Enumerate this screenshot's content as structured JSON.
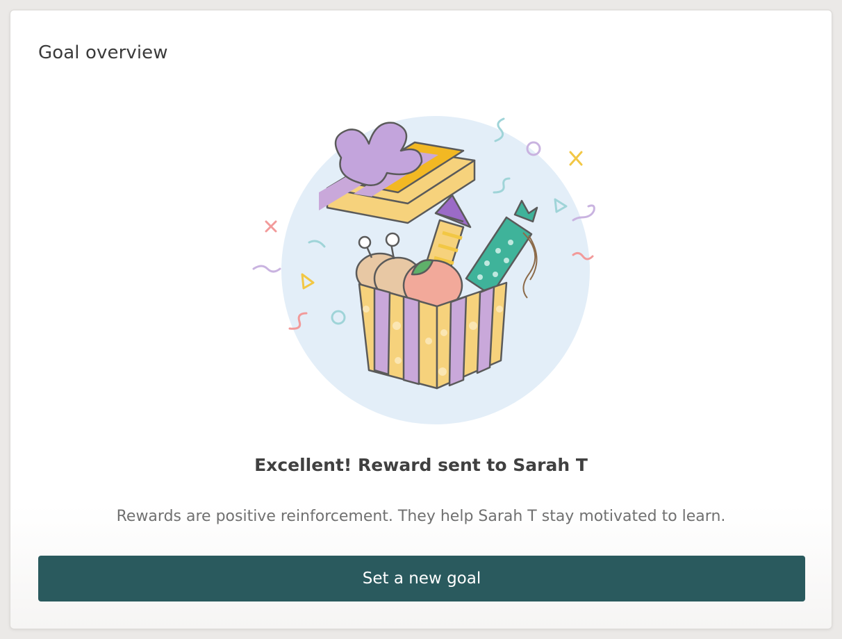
{
  "card": {
    "title": "Goal overview"
  },
  "illustration": {
    "icon": "gift-box-celebration",
    "colors": {
      "circle": "#e3eef8",
      "box_yellow": "#f6d27c",
      "box_purple": "#c9a8da",
      "bow_purple": "#c3a4dc",
      "rocket_purple": "#9b6bc7",
      "teal_cracker": "#3fb39a",
      "peach": "#f2a99a",
      "outline": "#5a5a5a"
    }
  },
  "message": {
    "headline": "Excellent! Reward sent to Sarah T",
    "subtext": "Rewards are positive reinforcement. They help Sarah T stay motivated to learn."
  },
  "actions": {
    "primary_label": "Set a new goal",
    "primary_color": "#2a5a5e"
  }
}
